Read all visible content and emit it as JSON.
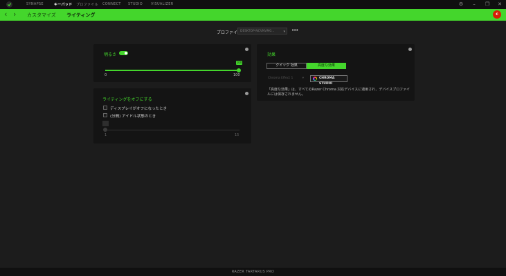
{
  "topnav": {
    "tabs": [
      {
        "label": "SYNAPSE"
      },
      {
        "label": "キーパッド"
      },
      {
        "label": "プロファイル"
      },
      {
        "label": "CONNECT"
      },
      {
        "label": "STUDIO"
      },
      {
        "label": "VISUALIZER"
      }
    ],
    "active_tab": "キーパッド"
  },
  "subnav": {
    "back_arrow": "‹",
    "forward_arrow": "›",
    "tabs": [
      {
        "label": "カスタマイズ"
      },
      {
        "label": "ライティング"
      }
    ],
    "active_tab": "ライティング"
  },
  "user": {
    "avatar_letter": "c"
  },
  "profile": {
    "label": "プロファイル",
    "selected": "DESKTOP-NCVNVM0...",
    "more": "•••"
  },
  "brightness": {
    "label": "明るさ",
    "enabled": true,
    "value_label": "100",
    "value": 100,
    "min_label": "0",
    "max_label": "100"
  },
  "lighting_off": {
    "title": "ライティングをオフにする",
    "option_display": "ディスプレイがオフになったとき",
    "option_idle": "(分間) アイドル状態のとき",
    "idle_min_label": "1",
    "idle_max_label": "15",
    "idle_value": 1
  },
  "effects": {
    "title": "効果",
    "quick_label": "クイック 効果",
    "advanced_label": "高度な効果",
    "active": "advanced",
    "dropdown_value": "Chroma Effect 1",
    "chroma_studio_label": "CHROMA STUDIO",
    "description": "「高度な効果」は、すべてのRazer Chroma 対応デバイスに適用され、デバイスプロファイルには保存されません。"
  },
  "footer": {
    "device_name": "RAZER TARTARUS PRO"
  },
  "colors": {
    "accent": "#44d62c",
    "background": "#1c1c1c",
    "card": "#141414",
    "avatar": "#d81e06"
  }
}
